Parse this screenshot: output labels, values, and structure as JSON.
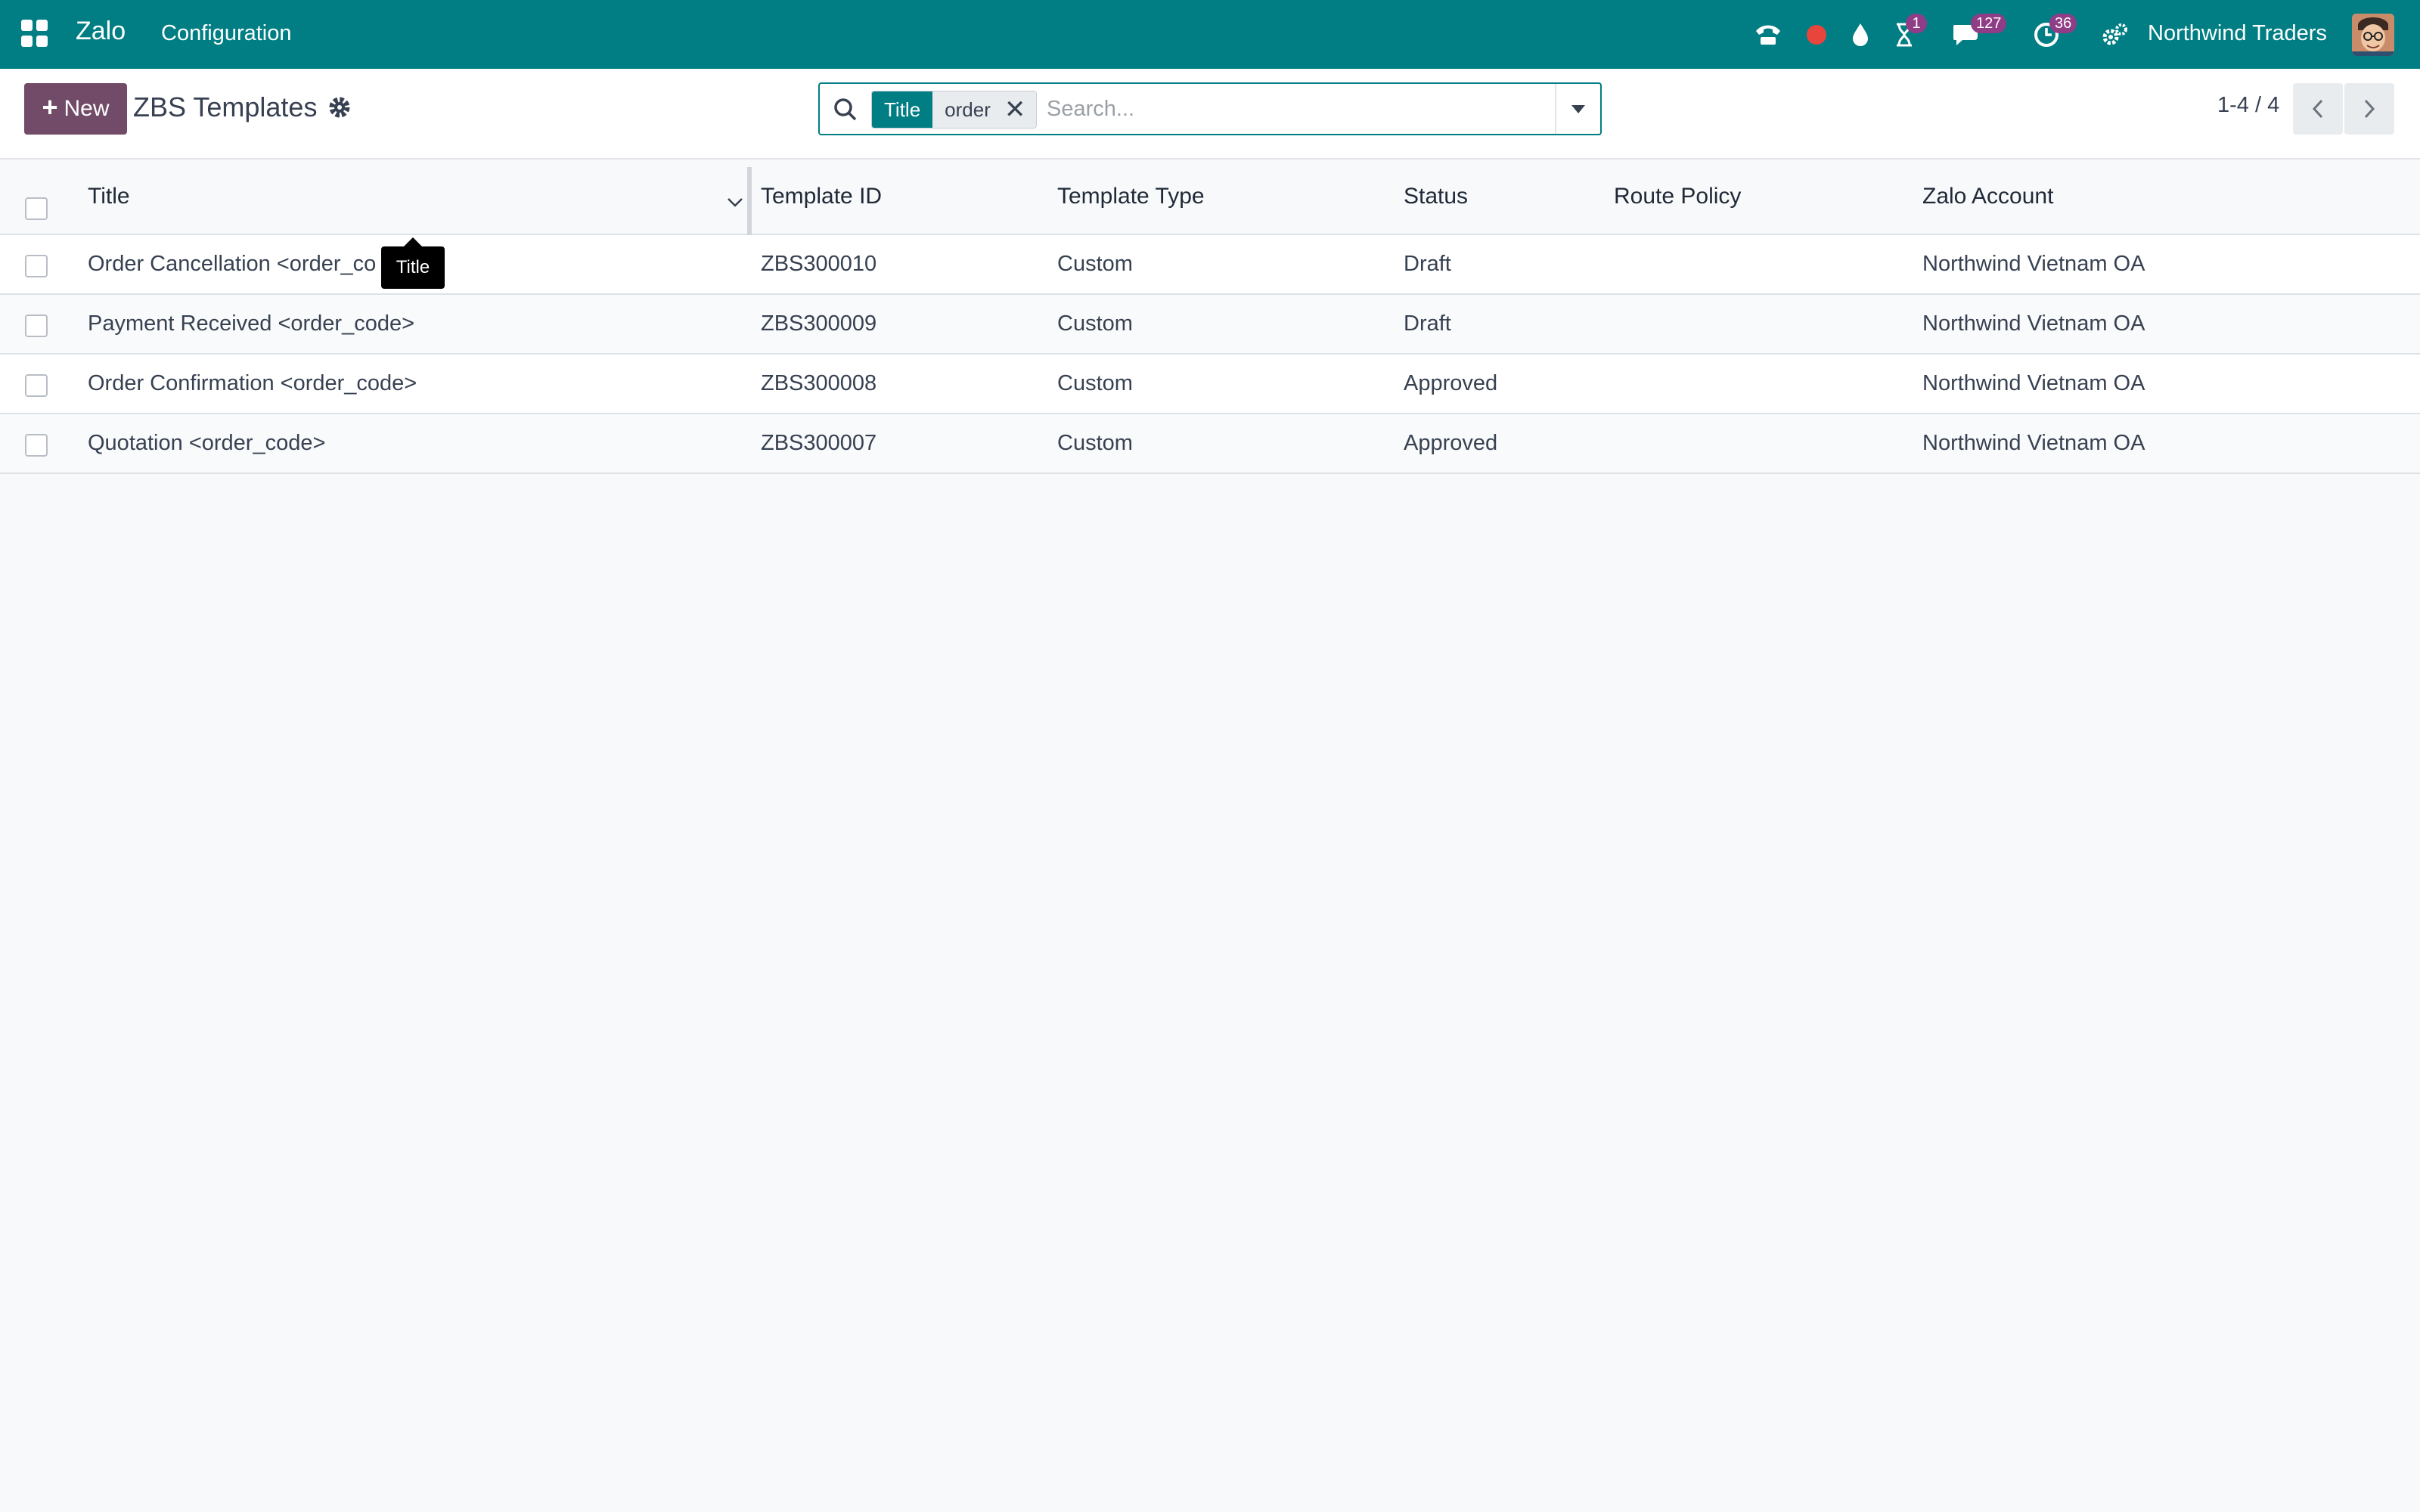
{
  "navbar": {
    "brand": "Zalo",
    "menu_items": [
      {
        "label": "Configuration"
      }
    ],
    "activity_badge": "1",
    "messages_badge": "127",
    "clock_badge": "36",
    "company": "Northwind Traders",
    "background_color": "#017e84",
    "icons": [
      "apps-grid-icon",
      "phone-icon",
      "record-dot-icon",
      "droplet-icon",
      "hourglass-icon",
      "chat-icon",
      "clock-icon",
      "settings-icon",
      "user-avatar"
    ]
  },
  "control_panel": {
    "new_button": "New",
    "title": "ZBS Templates",
    "search": {
      "facet_label": "Title",
      "facet_value": "order",
      "placeholder": "Search..."
    },
    "pager": "1-4 / 4"
  },
  "list": {
    "columns": [
      "Title",
      "Template ID",
      "Template Type",
      "Status",
      "Route Policy",
      "Zalo Account"
    ],
    "rows": [
      {
        "title": "Order Cancellation <order_co",
        "template_id": "ZBS300010",
        "template_type": "Custom",
        "status": "Draft",
        "route_policy": "",
        "zalo_account": "Northwind Vietnam OA"
      },
      {
        "title": "Payment Received <order_code>",
        "template_id": "ZBS300009",
        "template_type": "Custom",
        "status": "Draft",
        "route_policy": "",
        "zalo_account": "Northwind Vietnam OA"
      },
      {
        "title": "Order Confirmation <order_code>",
        "template_id": "ZBS300008",
        "template_type": "Custom",
        "status": "Approved",
        "route_policy": "",
        "zalo_account": "Northwind Vietnam OA"
      },
      {
        "title": "Quotation <order_code>",
        "template_id": "ZBS300007",
        "template_type": "Custom",
        "status": "Approved",
        "route_policy": "",
        "zalo_account": "Northwind Vietnam OA"
      }
    ]
  },
  "tooltip": "Title",
  "colors": {
    "accent": "#017e84",
    "primary_button": "#714b67",
    "badge": "#8f3d86"
  }
}
